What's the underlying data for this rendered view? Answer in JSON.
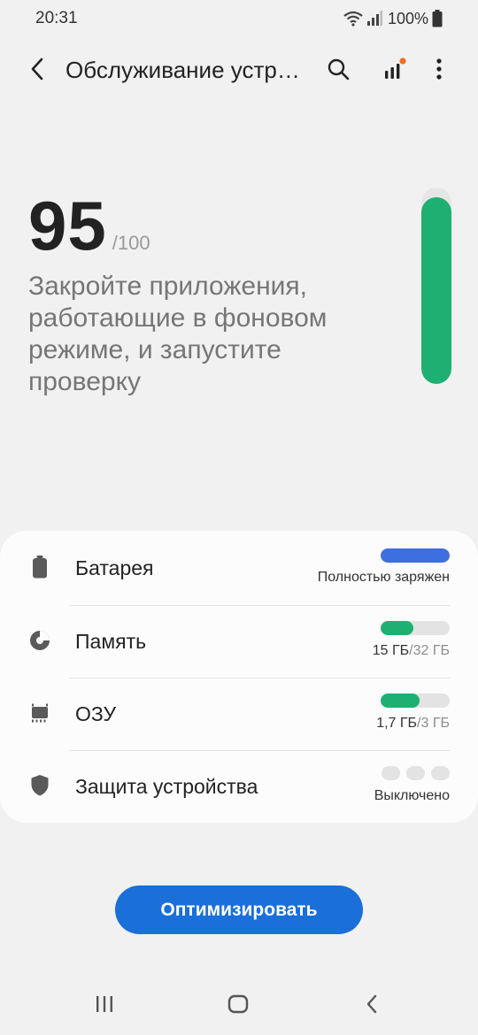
{
  "status_bar": {
    "time": "20:31",
    "battery": "100%"
  },
  "app_bar": {
    "title": "Обслуживание устройства",
    "back_icon": "chevron-left-icon",
    "search_icon": "search-icon",
    "diagnostics_icon": "signal-bars-icon",
    "more_icon": "more-vertical-icon"
  },
  "score": {
    "value": "95",
    "max": "/100",
    "fraction": 0.95,
    "message": "Закройте приложения, работающие в фоновом режиме, и запустите проверку",
    "color": "#1eb072"
  },
  "items": [
    {
      "label": "Батарея",
      "icon": "battery-icon",
      "status": "Полностью заряжен",
      "fraction": 1.0,
      "color": "#3e6fe0"
    },
    {
      "label": "Память",
      "icon": "storage-pie-icon",
      "status_value": "15 ГБ",
      "status_total": "/32 ГБ",
      "fraction": 0.47,
      "color": "#1eb072"
    },
    {
      "label": "ОЗУ",
      "icon": "memory-chip-icon",
      "status_value": "1,7 ГБ",
      "status_total": "/3 ГБ",
      "fraction": 0.57,
      "color": "#1eb072"
    },
    {
      "label": "Защита устройства",
      "icon": "shield-icon",
      "status": "Выключено"
    }
  ],
  "optimize_button": "Оптимизировать",
  "nav_bar": {
    "recents_icon": "recents-icon",
    "home_icon": "home-icon",
    "back_icon": "back-icon"
  }
}
